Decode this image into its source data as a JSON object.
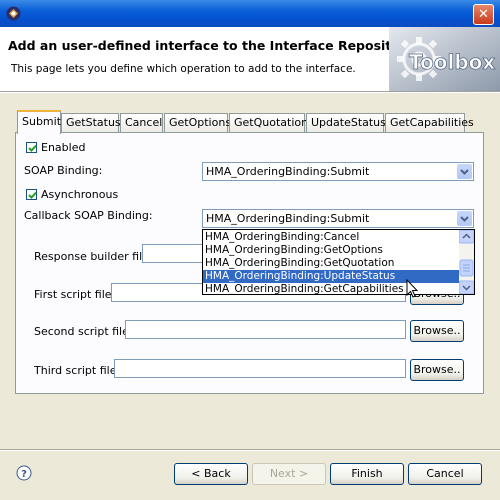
{
  "header": {
    "title": "Add an user-defined interface to the Interface Repository",
    "subtitle": "This page lets you define which operation to add to the interface.",
    "logo_text": "Toolbox"
  },
  "tabs": [
    "Submit",
    "GetStatus",
    "Cancel",
    "GetOptions",
    "GetQuotation",
    "UpdateStatus",
    "GetCapabilities"
  ],
  "form": {
    "enabled_label": "Enabled",
    "enabled_checked": true,
    "soap_binding_label": "SOAP Binding:",
    "soap_binding_value": "HMA_OrderingBinding:Submit",
    "asynchronous_label": "Asynchronous",
    "asynchronous_checked": true,
    "callback_label": "Callback SOAP Binding:",
    "callback_value": "HMA_OrderingBinding:Submit",
    "response_builder_label": "Response builder file:",
    "first_script_label": "First script file:",
    "second_script_label": "Second script file:",
    "third_script_label": "Third script file:",
    "browse_label": "Browse..",
    "first_browse_partial": "Browse.."
  },
  "dropdown": {
    "items": [
      "HMA_OrderingBinding:Cancel",
      "HMA_OrderingBinding:GetOptions",
      "HMA_OrderingBinding:GetQuotation",
      "HMA_OrderingBinding:UpdateStatus",
      "HMA_OrderingBinding:GetCapabilities"
    ],
    "selected": "HMA_OrderingBinding:UpdateStatus"
  },
  "buttons": {
    "back": "< Back",
    "next": "Next >",
    "finish": "Finish",
    "cancel": "Cancel"
  },
  "icons": {
    "help": "help-icon",
    "close": "close-icon",
    "app": "app-icon"
  },
  "colors": {
    "titlebar": "#0a5fd8",
    "selection": "#316ac5",
    "active_tab_accent": "#f0b43c"
  }
}
